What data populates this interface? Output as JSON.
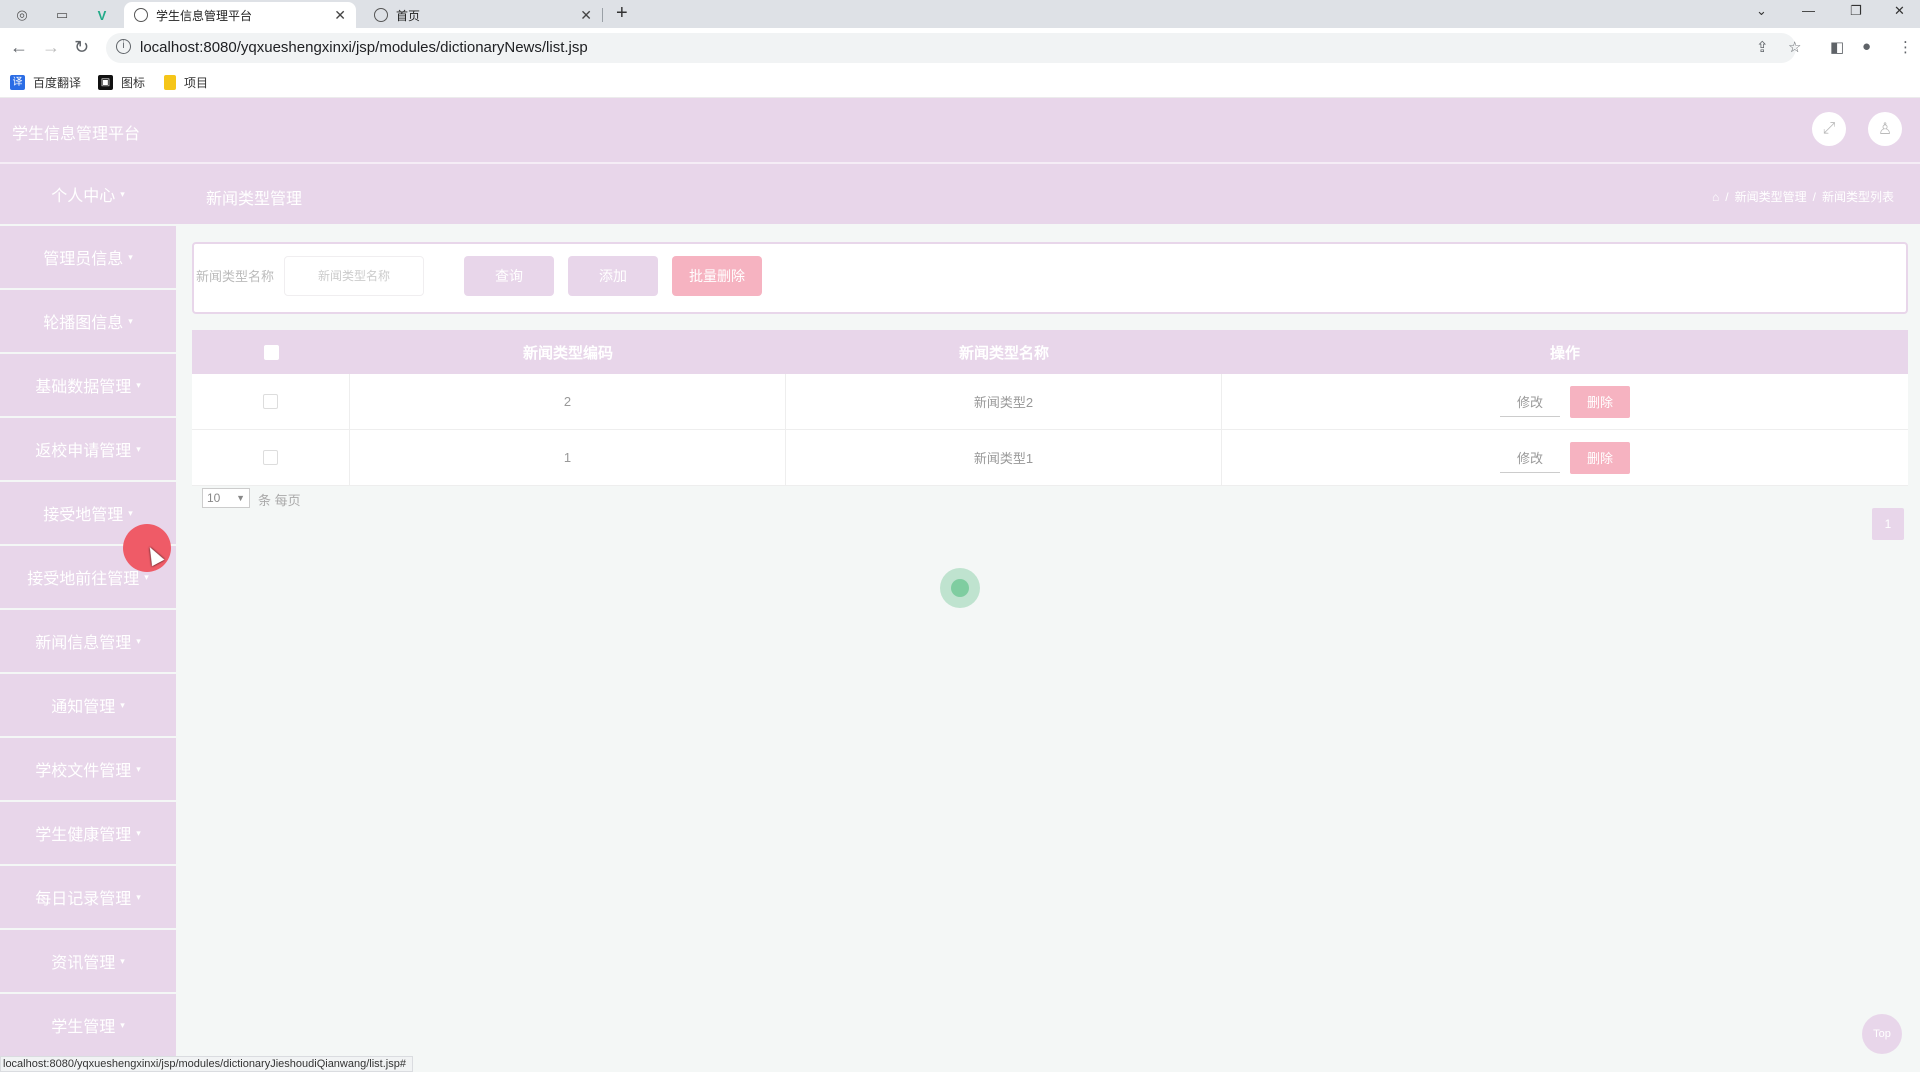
{
  "browser": {
    "tabs": [
      {
        "title": "学生信息管理平台",
        "active": true
      },
      {
        "title": "首页",
        "active": false
      }
    ],
    "url": "localhost:8080/yqxueshengxinxi/jsp/modules/dictionaryNews/list.jsp",
    "bookmarks": [
      "百度翻译",
      "图标",
      "项目"
    ],
    "status_url": "localhost:8080/yqxueshengxinxi/jsp/modules/dictionaryJieshoudiQianwang/list.jsp#"
  },
  "header": {
    "app_title": "学生信息管理平台"
  },
  "page": {
    "heading": "新闻类型管理",
    "breadcrumb": [
      "新闻类型管理",
      "新闻类型列表"
    ]
  },
  "sidebar": {
    "items": [
      {
        "label": "个人中心"
      },
      {
        "label": "管理员信息"
      },
      {
        "label": "轮播图信息"
      },
      {
        "label": "基础数据管理"
      },
      {
        "label": "返校申请管理"
      },
      {
        "label": "接受地管理"
      },
      {
        "label": "接受地前往管理"
      },
      {
        "label": "新闻信息管理"
      },
      {
        "label": "通知管理"
      },
      {
        "label": "学校文件管理"
      },
      {
        "label": "学生健康管理"
      },
      {
        "label": "每日记录管理"
      },
      {
        "label": "资讯管理"
      },
      {
        "label": "学生管理"
      }
    ]
  },
  "filter": {
    "label": "新闻类型名称",
    "placeholder": "新闻类型名称",
    "search_label": "查询",
    "add_label": "添加",
    "batch_delete_label": "批量删除"
  },
  "table": {
    "columns": [
      "新闻类型编码",
      "新闻类型名称",
      "操作"
    ],
    "rows": [
      {
        "code": "2",
        "name": "新闻类型2",
        "edit": "修改",
        "delete": "删除"
      },
      {
        "code": "1",
        "name": "新闻类型1",
        "edit": "修改",
        "delete": "删除"
      }
    ]
  },
  "pagination": {
    "page_size": "10",
    "page_size_label": "条 每页",
    "current_page": "1"
  },
  "top_button_label": "Top",
  "colors": {
    "theme": "#e8d6ea",
    "danger": "#f6b3c1",
    "background": "#f4f7f6"
  }
}
